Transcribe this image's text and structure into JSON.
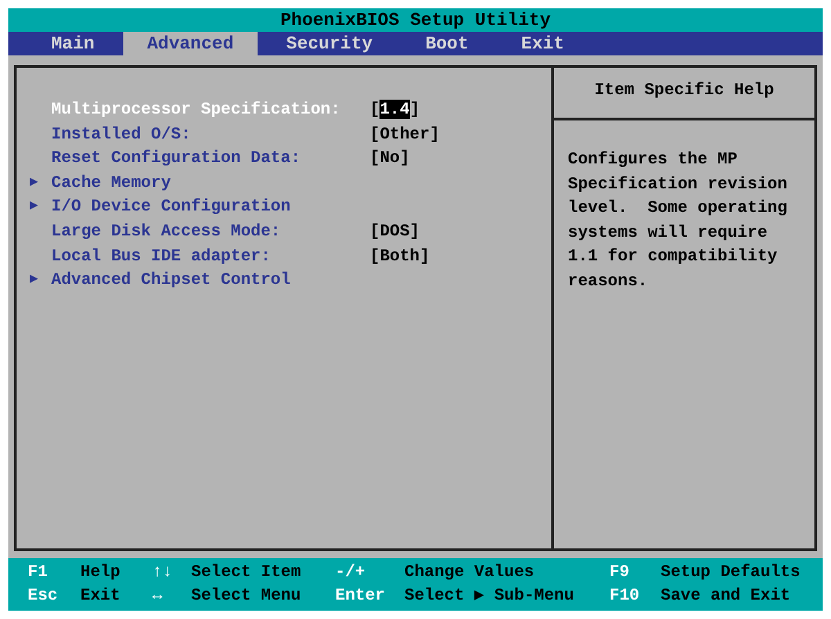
{
  "window": {
    "title": "PhoenixBIOS Setup Utility"
  },
  "tabs": [
    {
      "label": "Main",
      "selected": false
    },
    {
      "label": "Advanced",
      "selected": true
    },
    {
      "label": "Security",
      "selected": false
    },
    {
      "label": "Boot",
      "selected": false
    },
    {
      "label": "Exit",
      "selected": false
    }
  ],
  "settings": [
    {
      "kind": "option",
      "label": "Multiprocessor Specification:",
      "value": "[1.4]",
      "selected": true
    },
    {
      "kind": "option",
      "label": "Installed O/S:",
      "value": "[Other]",
      "selected": false
    },
    {
      "kind": "option",
      "label": "Reset Configuration Data:",
      "value": "[No]",
      "selected": false
    },
    {
      "kind": "submenu",
      "marker": "▶",
      "label": "Cache Memory",
      "selected": false
    },
    {
      "kind": "submenu",
      "marker": "▶",
      "label": "I/O Device Configuration",
      "selected": false
    },
    {
      "kind": "option",
      "label": "Large Disk Access Mode:",
      "value": "[DOS]",
      "selected": false
    },
    {
      "kind": "option",
      "label": "Local Bus IDE adapter:",
      "value": "[Both]",
      "selected": false
    },
    {
      "kind": "submenu",
      "marker": "▶",
      "label": "Advanced Chipset Control",
      "selected": false
    }
  ],
  "help": {
    "title": "Item Specific Help",
    "text": "Configures the MP Specification revision level.  Some operating systems will require 1.1 for compatibility reasons."
  },
  "footer": [
    [
      {
        "key": "F1",
        "action": "Help"
      },
      {
        "key": "↑↓",
        "action": "Select Item"
      },
      {
        "key": "-/+",
        "action": "Change Values"
      },
      {
        "key": "F9",
        "action": "Setup Defaults"
      }
    ],
    [
      {
        "key": "Esc",
        "action": "Exit"
      },
      {
        "key": "↔",
        "action": "Select Menu"
      },
      {
        "key": "Enter",
        "action": "Select ▶ Sub-Menu"
      },
      {
        "key": "F10",
        "action": "Save and Exit"
      }
    ]
  ]
}
